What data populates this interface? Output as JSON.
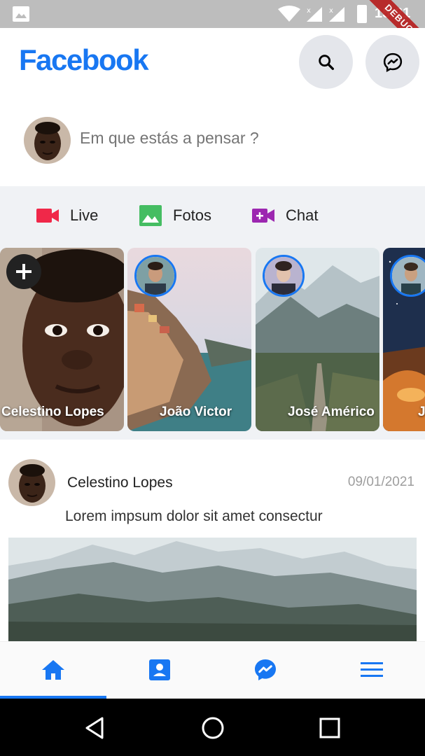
{
  "status_bar": {
    "time": "15:21",
    "debug_label": "DEBUG"
  },
  "app_bar": {
    "brand": "Facebook",
    "accent": "#1877f2"
  },
  "composer": {
    "placeholder": "Em que estás a pensar ?"
  },
  "actions": [
    {
      "label": "Live",
      "icon": "video-camera-icon",
      "color": "#f02849"
    },
    {
      "label": "Fotos",
      "icon": "photo-icon",
      "color": "#45bd62"
    },
    {
      "label": "Chat",
      "icon": "video-add-icon",
      "color": "#9c27b0"
    }
  ],
  "stories": [
    {
      "name": "Celestino Lopes"
    },
    {
      "name": "João Victor"
    },
    {
      "name": "José Américo"
    },
    {
      "name": "Je"
    }
  ],
  "post": {
    "author": "Celestino Lopes",
    "date": "09/01/2021",
    "text": "Lorem impsum dolor sit amet consectur"
  },
  "bottom_nav": {
    "items": [
      "home-icon",
      "profile-icon",
      "messenger-icon",
      "menu-icon"
    ],
    "active_index": 0
  }
}
